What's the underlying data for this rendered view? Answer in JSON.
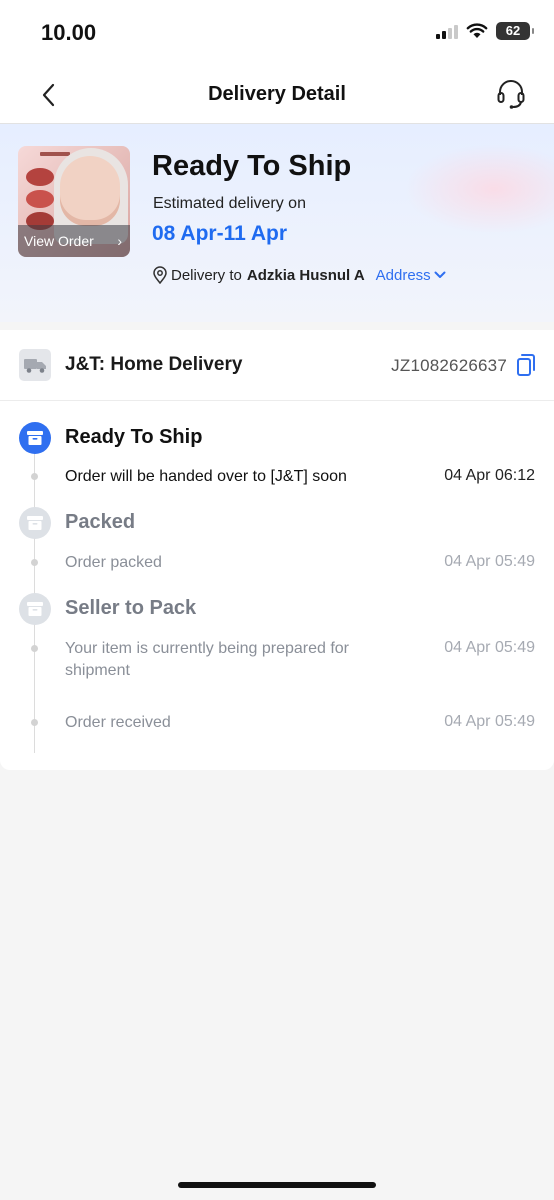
{
  "status_bar": {
    "time": "10.00",
    "battery": "62"
  },
  "header": {
    "title": "Delivery Detail"
  },
  "hero": {
    "status_title": "Ready To Ship",
    "estimated_label": "Estimated delivery on",
    "estimated_date": "08 Apr-11 Apr",
    "view_order_label": "View Order",
    "delivery_to_label": "Delivery to",
    "recipient_name": "Adzkia Husnul A",
    "address_link": "Address"
  },
  "courier": {
    "name": "J&T: Home Delivery",
    "tracking_number": "JZ1082626637"
  },
  "timeline": {
    "steps": [
      {
        "title": "Ready To Ship",
        "active": true
      },
      {
        "title": "Packed",
        "active": false
      },
      {
        "title": "Seller to Pack",
        "active": false
      }
    ],
    "events": [
      {
        "text": "Order will be handed over to [J&T] soon",
        "time": "04 Apr 06:12",
        "active": true
      },
      {
        "text": "Order packed",
        "time": "04 Apr 05:49",
        "active": false
      },
      {
        "text": "Your item is currently being prepared for shipment",
        "time": "04 Apr 05:49",
        "active": false
      },
      {
        "text": "Order received",
        "time": "04 Apr 05:49",
        "active": false
      }
    ]
  },
  "colors": {
    "accent": "#2f6ff0",
    "date_blue": "#1f6bf0",
    "muted_text": "#8a8f98",
    "inactive_icon": "#dde1e6"
  }
}
